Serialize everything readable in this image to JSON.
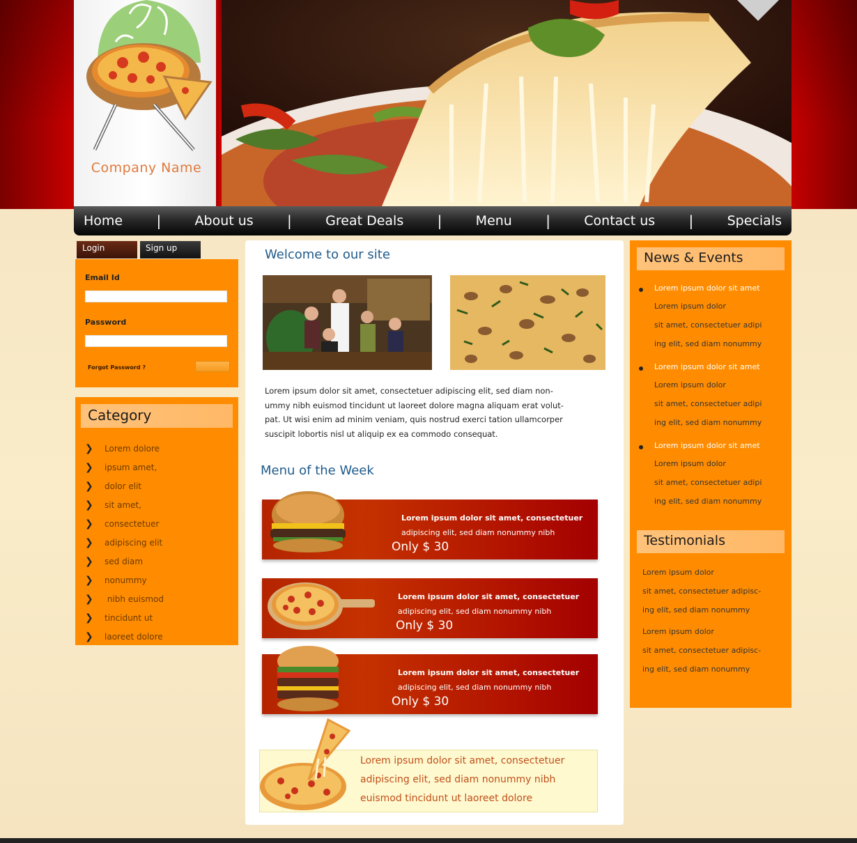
{
  "header": {
    "company_name": "Company Name"
  },
  "nav": {
    "items": [
      "Home",
      "About us",
      "Great Deals",
      "Menu",
      "Contact us",
      "Specials"
    ],
    "separator": "|"
  },
  "login": {
    "tab_login": "Login",
    "tab_signup": "Sign up",
    "email_label": "Email Id",
    "email_value": "",
    "password_label": "Password",
    "password_value": "",
    "forgot": "Forgot Password ?"
  },
  "category": {
    "title": "Category",
    "items": [
      "Lorem dolore",
      "ipsum amet,",
      "dolor elit",
      "sit amet,",
      "consectetuer",
      "adipiscing elit",
      "sed diam",
      "nonummy",
      " nibh euismod",
      "tincidunt ut",
      "laoreet dolore"
    ]
  },
  "main": {
    "welcome_title": "Welcome to our site",
    "intro_lines": [
      "Lorem ipsum dolor sit amet, consectetuer adipiscing elit, sed diam non-",
      "ummy nibh euismod tincidunt ut laoreet dolore magna aliquam erat volut-",
      "pat. Ut wisi enim ad minim veniam, quis nostrud exerci tation ullamcorper",
      "suscipit lobortis nisl ut aliquip ex ea commodo consequat."
    ],
    "menu_title": "Menu of the Week",
    "deals": [
      {
        "line1": "Lorem ipsum dolor sit amet, consectetuer",
        "line2": "adipiscing elit, sed diam nonummy nibh",
        "price": "Only $ 30"
      },
      {
        "line1": "Lorem ipsum dolor sit amet, consectetuer",
        "line2": "adipiscing elit, sed diam nonummy nibh",
        "price": "Only $ 30"
      },
      {
        "line1": "Lorem ipsum dolor sit amet, consectetuer",
        "line2": "adipiscing elit, sed diam nonummy nibh",
        "price": "Only $ 30"
      }
    ],
    "promo_lines": [
      "Lorem ipsum dolor sit amet, consectetuer",
      "adipiscing elit, sed diam nonummy nibh",
      "euismod tincidunt ut laoreet dolore"
    ]
  },
  "news": {
    "title": "News & Events",
    "items": [
      {
        "headline": "Lorem ipsum dolor sit amet",
        "lines": [
          "Lorem ipsum dolor",
          "sit amet, consectetuer adipi",
          "ing elit, sed diam nonummy"
        ]
      },
      {
        "headline": "Lorem ipsum dolor sit amet",
        "lines": [
          "Lorem ipsum dolor",
          "sit amet, consectetuer adipi",
          "ing elit, sed diam nonummy"
        ]
      },
      {
        "headline": "Lorem ipsum dolor sit amet",
        "lines": [
          "Lorem ipsum dolor",
          "sit amet, consectetuer adipi",
          "ing elit, sed diam nonummy"
        ]
      }
    ]
  },
  "testimonials": {
    "title": "Testimonials",
    "lines": [
      "Lorem ipsum dolor",
      "sit amet, consectetuer adipisc-",
      "ing elit, sed diam nonummy",
      "Lorem ipsum dolor",
      "sit amet, consectetuer adipisc-",
      "ing elit, sed diam nonummy"
    ]
  },
  "colors": {
    "brand_red": "#c80000",
    "orange": "#ff8c00",
    "title_blue": "#1f5a8a"
  }
}
